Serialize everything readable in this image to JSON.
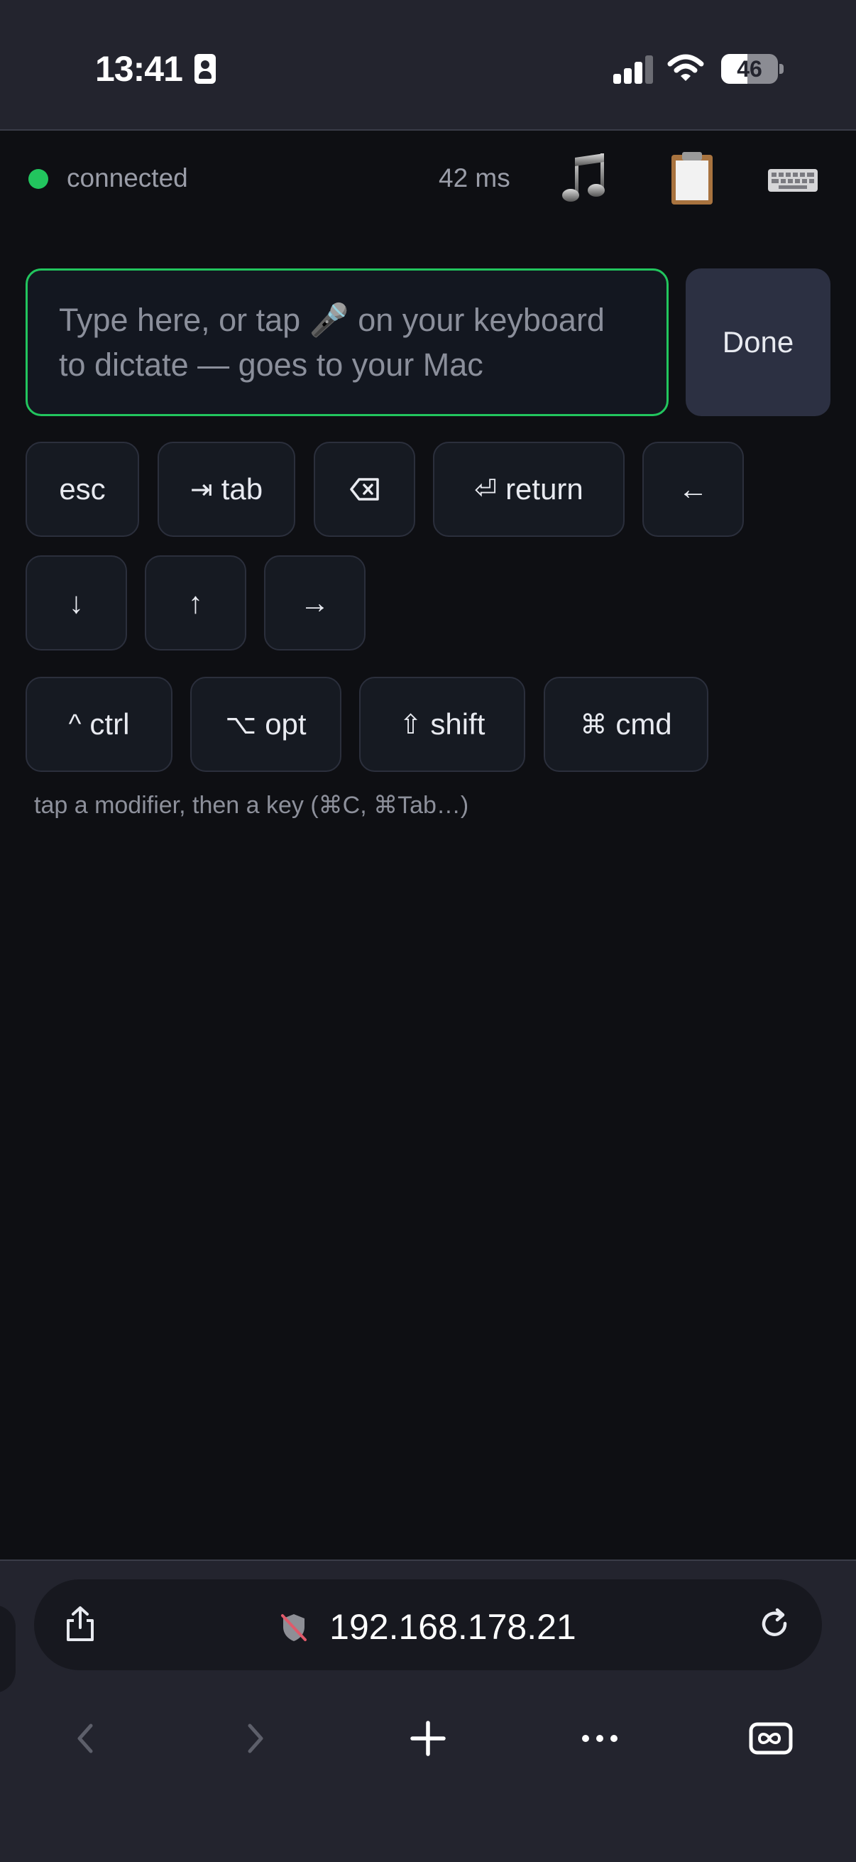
{
  "status_bar": {
    "time": "13:41",
    "battery": "46",
    "battery_level": 0.46,
    "signal_bars_active": 3
  },
  "top_bar": {
    "connection_status": "connected",
    "connection_color": "#22c55e",
    "latency": "42 ms",
    "icons": [
      "music-note-icon",
      "clipboard-icon",
      "keyboard-icon"
    ]
  },
  "input": {
    "placeholder": "Type here, or tap 🎤 on your keyboard to dictate — goes to your Mac",
    "value": ""
  },
  "done_label": "Done",
  "keys_row1": [
    {
      "symbol": "",
      "label": "esc"
    },
    {
      "symbol": "⇥",
      "label": "tab"
    },
    {
      "symbol": "⌫",
      "label": ""
    },
    {
      "symbol": "⏎",
      "label": "return"
    },
    {
      "symbol": "←",
      "label": ""
    }
  ],
  "keys_row2": [
    {
      "symbol": "↓",
      "label": ""
    },
    {
      "symbol": "↑",
      "label": ""
    },
    {
      "symbol": "→",
      "label": ""
    }
  ],
  "modifiers": [
    {
      "symbol": "^",
      "label": "ctrl"
    },
    {
      "symbol": "⌥",
      "label": "opt"
    },
    {
      "symbol": "⇧",
      "label": "shift"
    },
    {
      "symbol": "⌘",
      "label": "cmd"
    }
  ],
  "hint": "tap a modifier, then a key (⌘C, ⌘Tab…)",
  "browser": {
    "url": "192.168.178.21",
    "icons": [
      "share-icon",
      "not-secure-icon",
      "reload-icon",
      "back-icon",
      "forward-icon",
      "new-tab-icon",
      "more-icon",
      "tabs-icon"
    ]
  }
}
